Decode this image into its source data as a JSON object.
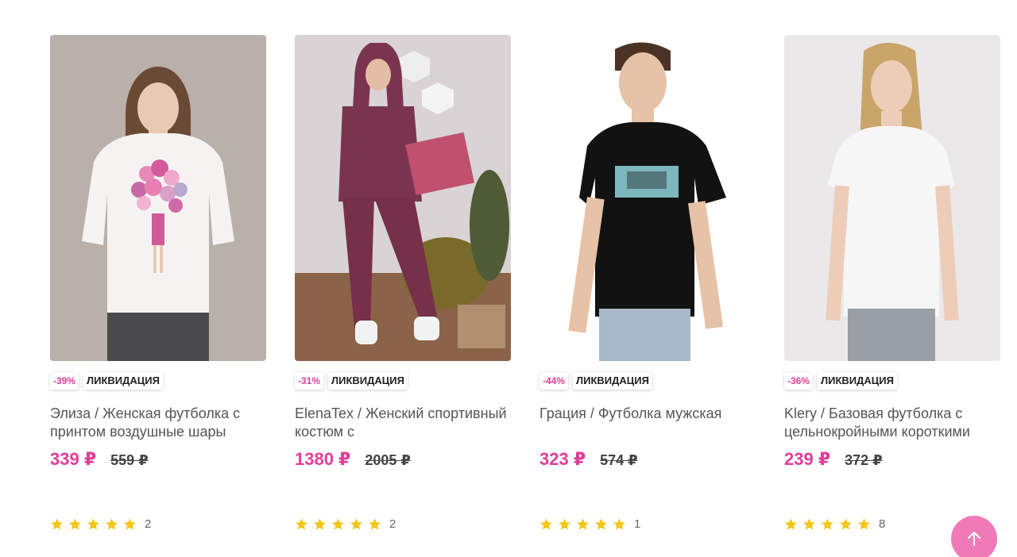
{
  "products": [
    {
      "discount": "-39%",
      "tag": "ЛИКВИДАЦИЯ",
      "title": "Элиза / Женская футболка с принтом воздушные шары",
      "price": "339 ₽",
      "old_price": "559 ₽",
      "rating": 5,
      "reviews": "2"
    },
    {
      "discount": "-31%",
      "tag": "ЛИКВИДАЦИЯ",
      "title": "ElenaTex / Женский спортивный костюм с",
      "price": "1380 ₽",
      "old_price": "2005 ₽",
      "rating": 5,
      "reviews": "2"
    },
    {
      "discount": "-44%",
      "tag": "ЛИКВИДАЦИЯ",
      "title": "Грация / Футболка мужская",
      "price": "323 ₽",
      "old_price": "574 ₽",
      "rating": 5,
      "reviews": "1"
    },
    {
      "discount": "-36%",
      "tag": "ЛИКВИДАЦИЯ",
      "title": "Klery / Базовая футболка с цельнокройными короткими",
      "price": "239 ₽",
      "old_price": "372 ₽",
      "rating": 5,
      "reviews": "8"
    }
  ],
  "scroll_top_icon": "arrow-up-icon",
  "colors": {
    "accent": "#e23d9a",
    "star": "#f5c518",
    "fab": "#f07ab8"
  }
}
